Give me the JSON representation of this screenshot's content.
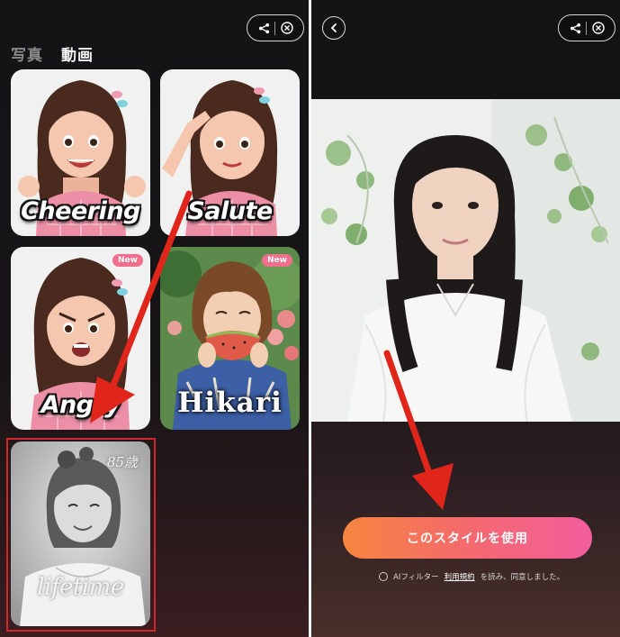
{
  "left": {
    "tabs": [
      {
        "label": "写真",
        "active": false
      },
      {
        "label": "動画",
        "active": true
      }
    ],
    "cards": [
      {
        "label": "Cheering",
        "badge": ""
      },
      {
        "label": "Salute",
        "badge": ""
      },
      {
        "label": "Angry",
        "badge": "New"
      },
      {
        "label": "Hikari",
        "badge": "New"
      },
      {
        "label": "lifetime",
        "badge": "",
        "age": "85歳",
        "selected": true
      }
    ],
    "toolbar": {
      "share_icon": "share-icon",
      "close_icon": "close-circle-icon"
    }
  },
  "right": {
    "back_icon": "chevron-left-icon",
    "toolbar": {
      "share_icon": "share-icon",
      "close_icon": "close-circle-icon"
    },
    "use_style_button": "このスタイルを使用",
    "agreement": {
      "prefix": "AIフィルター",
      "terms_link": "利用規約",
      "suffix": "を読み、同意しました。"
    }
  },
  "colors": {
    "accent_gradient_start": "#f6853f",
    "accent_gradient_end": "#f25d9e",
    "annotation_red": "#e0251b",
    "new_badge": "#f06f8c"
  }
}
